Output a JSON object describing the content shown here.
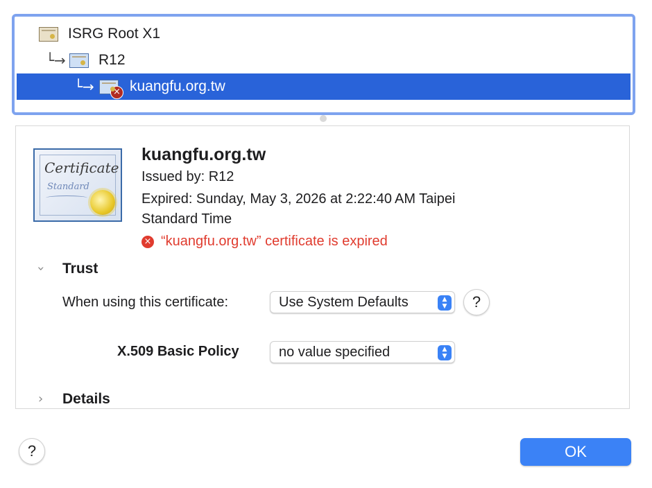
{
  "chain": {
    "items": [
      {
        "label": "ISRG Root X1",
        "icon": "certificate-icon",
        "level": 0,
        "selected": false
      },
      {
        "label": "R12",
        "icon": "certificate-icon",
        "level": 1,
        "selected": false
      },
      {
        "label": "kuangfu.org.tw",
        "icon": "certificate-error-icon",
        "level": 2,
        "selected": true
      }
    ],
    "arrow": "└→",
    "selection_color": "#2963d9"
  },
  "certificate": {
    "name": "kuangfu.org.tw",
    "issued_by": "Issued by: R12",
    "expired_line1": "Expired: Sunday, May 3, 2026 at 2:22:40 AM Taipei",
    "expired_line2": "Standard Time",
    "error_message": "“kuangfu.org.tw” certificate is expired",
    "error_color": "#e03b2e",
    "image_text_main": "Certificate",
    "image_text_sub": "Standard"
  },
  "trust": {
    "heading": "Trust",
    "expanded": true,
    "when_using_label": "When using this certificate:",
    "when_using_value": "Use System Defaults",
    "x509_label": "X.509 Basic Policy",
    "x509_value": "no value specified"
  },
  "details": {
    "heading": "Details",
    "expanded": false
  },
  "buttons": {
    "help": "?",
    "ok": "OK",
    "accent": "#3b82f6"
  }
}
